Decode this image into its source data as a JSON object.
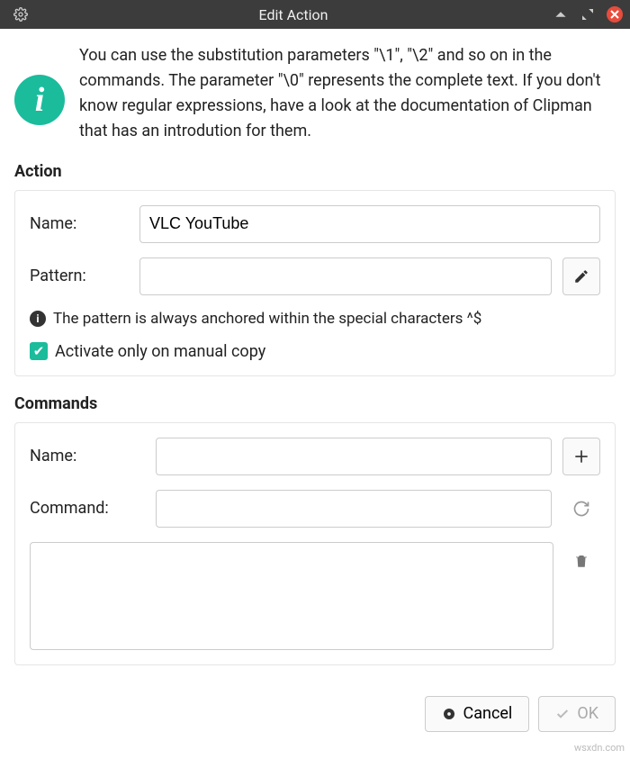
{
  "titlebar": {
    "title": "Edit Action"
  },
  "intro": {
    "icon_glyph": "i",
    "text": "You can use the substitution parameters \"\\1\", \"\\2\" and so on in the commands. The parameter \"\\0\" represents the complete text. If you don't know regular expressions, have a look at the documentation of Clipman that has an introdution for them."
  },
  "action": {
    "heading": "Action",
    "name_label": "Name:",
    "name_value": "VLC YouTube",
    "pattern_label": "Pattern:",
    "pattern_value": "",
    "hint": "The pattern is always anchored within the special characters ^$",
    "checkbox_label": "Activate only on manual copy",
    "checkbox_checked": true
  },
  "commands": {
    "heading": "Commands",
    "name_label": "Name:",
    "name_value": "",
    "command_label": "Command:",
    "command_value": "",
    "list_value": ""
  },
  "footer": {
    "cancel": "Cancel",
    "ok": "OK"
  },
  "watermark": "wsxdn.com"
}
